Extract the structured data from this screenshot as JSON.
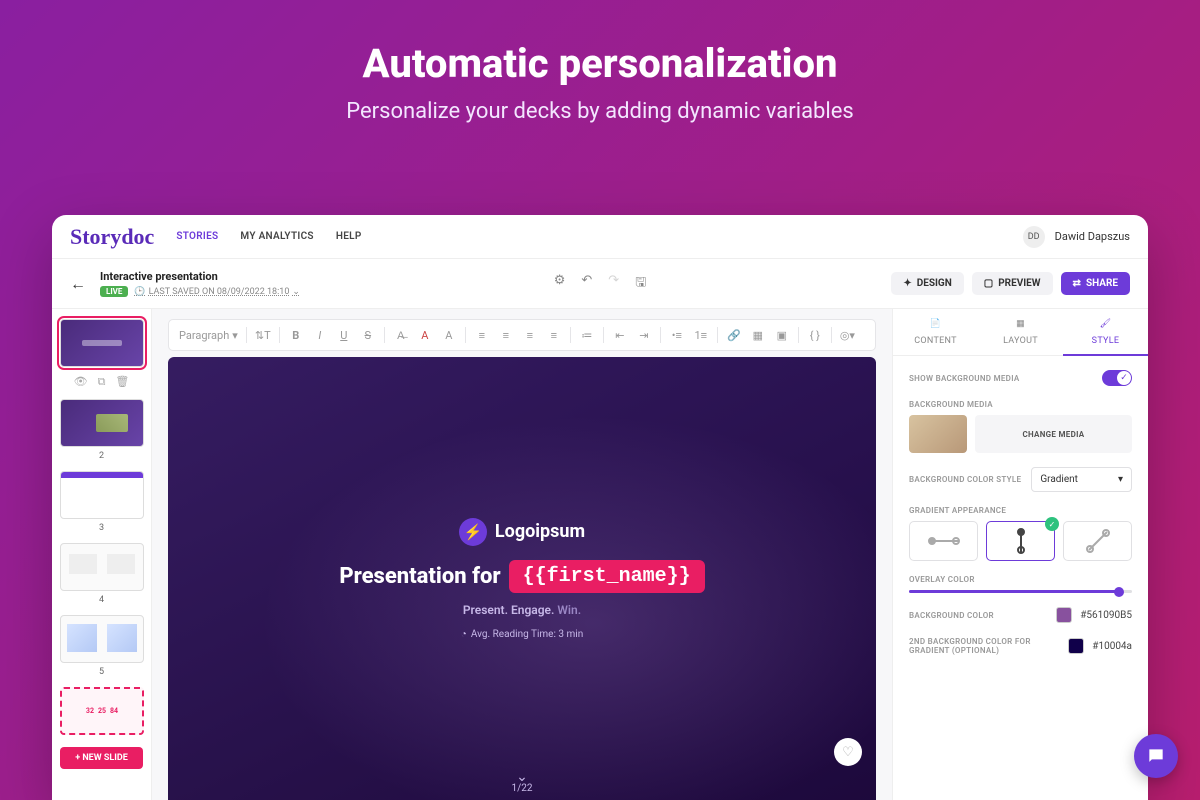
{
  "hero": {
    "title": "Automatic personalization",
    "subtitle": "Personalize your decks by adding dynamic variables"
  },
  "nav": {
    "brand": "Storydoc",
    "items": [
      "STORIES",
      "MY ANALYTICS",
      "HELP"
    ],
    "initials": "DD",
    "name": "Dawid Dapszus"
  },
  "meta": {
    "title": "Interactive presentation",
    "badge": "LIVE",
    "last_saved": "LAST SAVED ON 08/09/2022 18:10"
  },
  "actions": {
    "design": "DESIGN",
    "preview": "PREVIEW",
    "share": "SHARE"
  },
  "toolbar": {
    "paragraph": "Paragraph"
  },
  "slides": {
    "numbers": [
      "",
      "2",
      "3",
      "4",
      "5"
    ],
    "stats": [
      "32",
      "25",
      "84"
    ],
    "new_slide": "+ NEW SLIDE"
  },
  "canvas": {
    "logo": "Logoipsum",
    "pres_prefix": "Presentation for",
    "variable": "{{first_name}}",
    "tagline": [
      "Present.",
      "Engage.",
      "Win."
    ],
    "reading": "Avg. Reading Time: 3 min",
    "page": "1/22"
  },
  "inspector": {
    "tabs": {
      "content": "CONTENT",
      "layout": "LAYOUT",
      "style": "STYLE"
    },
    "show_bg_media": "SHOW BACKGROUND MEDIA",
    "bg_media": "BACKGROUND MEDIA",
    "change_media": "CHANGE MEDIA",
    "bg_color_style": "BACKGROUND COLOR STYLE",
    "bg_color_style_value": "Gradient",
    "gradient_appearance": "GRADIENT APPEARANCE",
    "overlay_color": "OVERLAY COLOR",
    "background_color": "BACKGROUND COLOR",
    "bg_hex": "#561090B5",
    "second_bg": "2ND BACKGROUND COLOR FOR GRADIENT (OPTIONAL)",
    "bg2_hex": "#10004a",
    "colors": {
      "swatch1": "#88519e",
      "swatch2": "#10004a"
    }
  }
}
